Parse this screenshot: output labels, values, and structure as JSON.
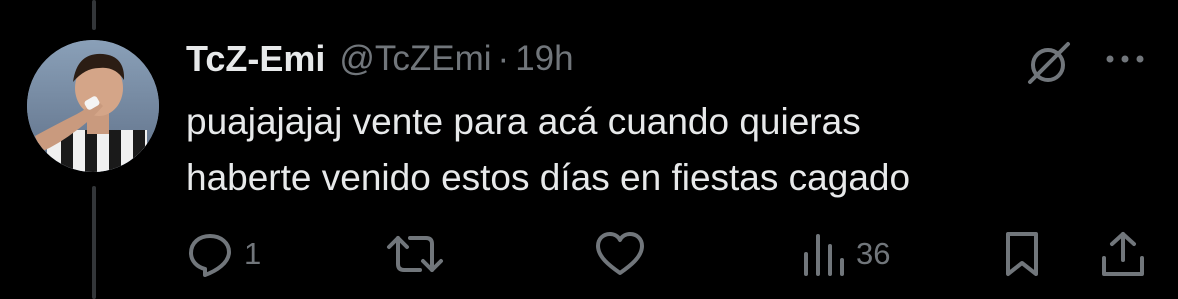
{
  "tweet": {
    "display_name": "TcZ-Emi",
    "handle": "@TcZEmi",
    "separator": "·",
    "time": "19h",
    "text": "puajajajaj vente para acá cuando quieras\nhaberte venido estos días en fiestas cagado"
  },
  "actions": {
    "reply_count": "1",
    "views_count": "36"
  },
  "icons": {
    "avatar": "user-avatar",
    "grok": "grok-icon",
    "more": "more-icon",
    "reply": "reply-icon",
    "retweet": "retweet-icon",
    "like": "heart-icon",
    "views": "views-icon",
    "bookmark": "bookmark-icon",
    "share": "share-icon"
  },
  "colors": {
    "background": "#000000",
    "primary_text": "#e7e9ea",
    "secondary_text": "#71767b",
    "thread_line": "#333639"
  }
}
